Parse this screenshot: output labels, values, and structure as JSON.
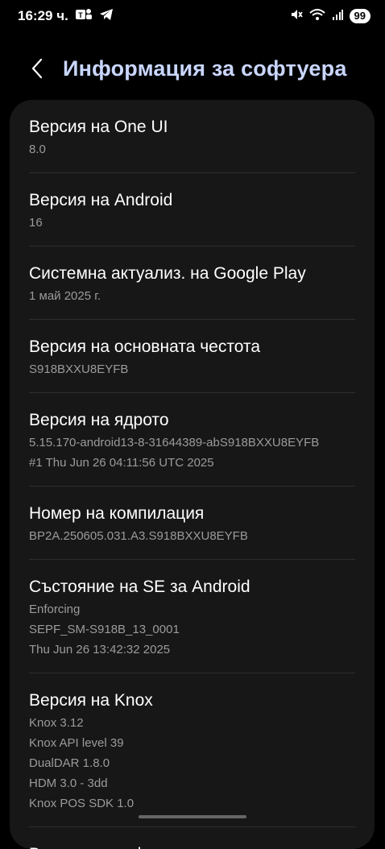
{
  "status": {
    "time": "16:29 ч.",
    "battery": "99",
    "icons": [
      "teams-icon",
      "telegram-icon",
      "mute-icon",
      "wifi-icon",
      "signal-icon"
    ]
  },
  "header": {
    "title": "Информация за софтуера",
    "back_icon": "chevron-left-icon"
  },
  "items": [
    {
      "title": "Версия на One UI",
      "lines": [
        "8.0"
      ]
    },
    {
      "title": "Версия на Android",
      "lines": [
        "16"
      ]
    },
    {
      "title": "Системна актуализ. на Google Play",
      "lines": [
        "1 май 2025 г."
      ]
    },
    {
      "title": "Версия на основната честота",
      "lines": [
        "S918BXXU8EYFB"
      ]
    },
    {
      "title": "Версия на ядрото",
      "lines": [
        "5.15.170-android13-8-31644389-abS918BXXU8EYFB",
        "#1 Thu Jun 26 04:11:56 UTC 2025"
      ]
    },
    {
      "title": "Номер на компилация",
      "lines": [
        "BP2A.250605.031.A3.S918BXXU8EYFB"
      ]
    },
    {
      "title": "Състояние на SE за Android",
      "lines": [
        "Enforcing",
        "SEPF_SM-S918B_13_0001",
        "Thu Jun 26 13:42:32 2025"
      ]
    },
    {
      "title": "Версия на Knox",
      "lines": [
        "Knox 3.12",
        "Knox API level 39",
        "DualDAR 1.8.0",
        "HDM 3.0 - 3dd",
        "Knox POS SDK 1.0"
      ]
    },
    {
      "title": "Версия на софтуера на доставчика на",
      "lines": []
    }
  ]
}
